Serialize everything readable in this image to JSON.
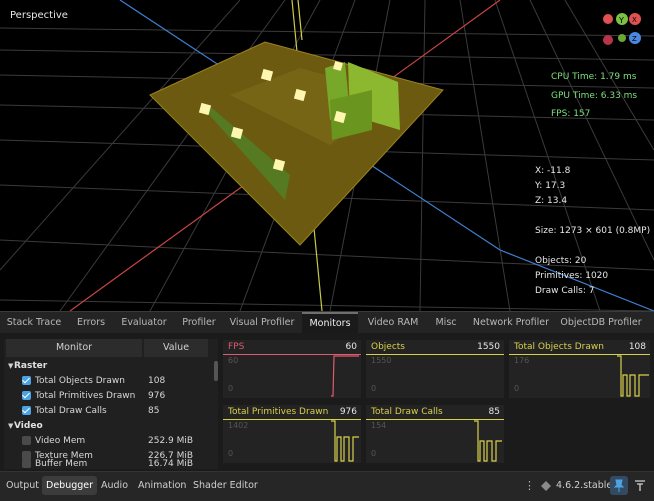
{
  "viewport": {
    "label": "Perspective",
    "gizmo_axes": {
      "y": "Y",
      "x": "X",
      "z": "Z"
    },
    "timing": {
      "cpu": "CPU Time: 1.79 ms",
      "gpu": "GPU Time: 6.33 ms",
      "fps": "FPS: 157"
    },
    "position": {
      "x": "X:  -11.8",
      "y": "Y:  17.3",
      "z": "Z:  13.4"
    },
    "size": "Size: 1273 × 601 (0.8MP)",
    "counts": {
      "objects": "Objects: 20",
      "primitives": "Primitives: 1020",
      "draw_calls": "Draw Calls: 7"
    }
  },
  "tabs": [
    "Stack Trace",
    "Errors",
    "Evaluator",
    "Profiler",
    "Visual Profiler",
    "Monitors",
    "Video RAM",
    "Misc",
    "Network Profiler",
    "ObjectDB Profiler"
  ],
  "monitor_list": {
    "header": {
      "monitor": "Monitor",
      "value": "Value"
    },
    "groups": [
      {
        "name": "Raster",
        "items": [
          {
            "label": "Total Objects Drawn",
            "value": "108",
            "checked": true
          },
          {
            "label": "Total Primitives Drawn",
            "value": "976",
            "checked": true
          },
          {
            "label": "Total Draw Calls",
            "value": "85",
            "checked": true
          }
        ]
      },
      {
        "name": "Video",
        "items": [
          {
            "label": "Video Mem",
            "value": "252.9 MiB",
            "checked": false
          },
          {
            "label": "Texture Mem",
            "value": "226.7 MiB",
            "checked": false
          },
          {
            "label": "Buffer Mem",
            "value": "16.74 MiB",
            "checked": false
          }
        ]
      }
    ]
  },
  "graphs": {
    "fps": {
      "title": "FPS",
      "value": "60",
      "max": "60",
      "min": "0"
    },
    "objects": {
      "title": "Objects",
      "value": "1550",
      "max": "1550",
      "min": "0"
    },
    "total_objects_drawn": {
      "title": "Total Objects Drawn",
      "value": "108",
      "max": "176",
      "min": "0"
    },
    "total_primitives_drawn": {
      "title": "Total Primitives Drawn",
      "value": "976",
      "max": "1402",
      "min": "0"
    },
    "total_draw_calls": {
      "title": "Total Draw Calls",
      "value": "85",
      "max": "154",
      "min": "0"
    }
  },
  "bottom": {
    "tabs": [
      "Output",
      "Debugger",
      "Audio",
      "Animation",
      "Shader Editor"
    ],
    "version": "4.6.2.stable"
  },
  "colors": {
    "fps_series": "#e05a6e",
    "series": "#d9d04a",
    "accent": "#4ba3e3",
    "stats_green": "#7ee07e"
  }
}
